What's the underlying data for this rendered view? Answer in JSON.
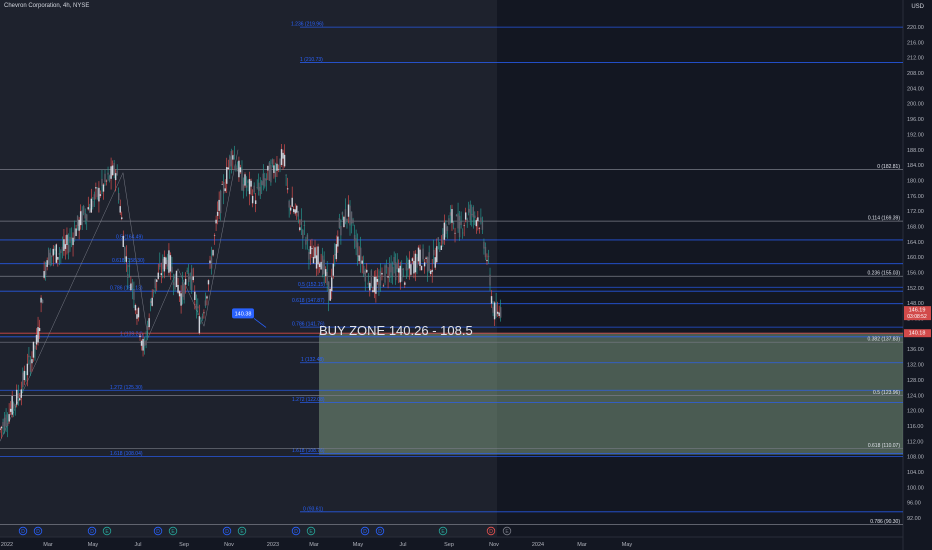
{
  "header": {
    "title": "Chevron Corporation, 4h, NYSE",
    "currency": "USD"
  },
  "buy_zone_label": "BUY ZONE 140.26 - 108.5",
  "colors": {
    "bg": "#131722",
    "fib_line": "#2962ff",
    "fib_text": "#2962ff",
    "white_line": "#787b86",
    "zone_fill": "#8fb08f",
    "up": "#c8c8c8",
    "down": "#c8c8c8",
    "price_tag": "#d24a4a"
  },
  "chart_data": {
    "type": "candlestick",
    "y_axis": {
      "range": [
        92,
        222
      ],
      "ticks": [
        92,
        96,
        100,
        104,
        108,
        112,
        116,
        120,
        124,
        128,
        132,
        136,
        140,
        144,
        148,
        152,
        156,
        160,
        164,
        168,
        172,
        176,
        180,
        184,
        188,
        192,
        196,
        200,
        204,
        208,
        212,
        216,
        220
      ],
      "labels": [
        "92.00",
        "96.00",
        "100.00",
        "104.00",
        "108.00",
        "112.00",
        "116.00",
        "120.00",
        "124.00",
        "128.00",
        "132.00",
        "136.00",
        "140.00",
        "144.00",
        "148.00",
        "152.00",
        "156.00",
        "160.00",
        "164.00",
        "168.00",
        "172.00",
        "176.00",
        "180.00",
        "184.00",
        "188.00",
        "192.00",
        "196.00",
        "200.00",
        "204.00",
        "208.00",
        "212.00",
        "216.00",
        "220.00"
      ]
    },
    "x_axis": {
      "labels": [
        "2022",
        "Mar",
        "May",
        "Jul",
        "Sep",
        "Nov",
        "2023",
        "Mar",
        "May",
        "Jul",
        "Sep",
        "Nov",
        "2024",
        "Mar",
        "May"
      ]
    },
    "fib_levels": [
      {
        "text": "1.236 (219.96)",
        "price": 219.96,
        "scope": "upper"
      },
      {
        "text": "1 (210.73)",
        "price": 210.73,
        "scope": "upper"
      },
      {
        "text": "0.5 (164.49)",
        "price": 164.49,
        "scope": "left"
      },
      {
        "text": "0.618 (158.30)",
        "price": 158.3,
        "scope": "left"
      },
      {
        "text": "0.786 (151.13)",
        "price": 151.13,
        "scope": "left"
      },
      {
        "text": "1 (139.24)",
        "price": 139.24,
        "scope": "left"
      },
      {
        "text": "1.272 (125.30)",
        "price": 125.3,
        "scope": "left"
      },
      {
        "text": "1.618 (108.04)",
        "price": 108.04,
        "scope": "left"
      },
      {
        "text": "0.5 (152.15)",
        "price": 152.15,
        "scope": "mid"
      },
      {
        "text": "0.618 (147.87)",
        "price": 147.87,
        "scope": "mid"
      },
      {
        "text": "0.786 (141.76)",
        "price": 141.76,
        "scope": "mid"
      },
      {
        "text": "1 (132.48)",
        "price": 132.48,
        "scope": "mid"
      },
      {
        "text": "1.272 (122.08)",
        "price": 122.08,
        "scope": "mid"
      },
      {
        "text": "1.618 (108.76)",
        "price": 108.76,
        "scope": "mid"
      },
      {
        "text": "0 (93.61)",
        "price": 93.61,
        "scope": "mid"
      }
    ],
    "right_fib_levels": [
      {
        "text": "0 (182.81)",
        "price": 182.81
      },
      {
        "text": "0.114 (169.39)",
        "price": 169.39
      },
      {
        "text": "0.236 (155.03)",
        "price": 155.03
      },
      {
        "text": "0.382 (137.83)",
        "price": 137.83
      },
      {
        "text": "0.5 (123.96)",
        "price": 123.96
      },
      {
        "text": "0.618 (110.07)",
        "price": 110.07
      },
      {
        "text": "0.786 (90.30)",
        "price": 90.3
      }
    ],
    "buy_zone": {
      "top": 140.26,
      "bottom": 108.5
    },
    "price_tags": [
      {
        "text": "146.19",
        "sub": "03:08:52",
        "price": 146.19
      },
      {
        "text": "140.18",
        "price": 140.18
      }
    ],
    "callout": {
      "text": "140.38",
      "price": 140.38
    },
    "event_markers": [
      "D",
      "D",
      "D",
      "E",
      "D",
      "E",
      "D",
      "E",
      "D",
      "E",
      "D",
      "D",
      "E",
      "D",
      "E"
    ],
    "price_path": [
      [
        0.0,
        115
      ],
      [
        0.02,
        124
      ],
      [
        0.04,
        138
      ],
      [
        0.05,
        160
      ],
      [
        0.07,
        162
      ],
      [
        0.09,
        171
      ],
      [
        0.11,
        178
      ],
      [
        0.125,
        183
      ],
      [
        0.135,
        160
      ],
      [
        0.145,
        150
      ],
      [
        0.155,
        135
      ],
      [
        0.165,
        152
      ],
      [
        0.18,
        160
      ],
      [
        0.195,
        150
      ],
      [
        0.205,
        156
      ],
      [
        0.215,
        142
      ],
      [
        0.225,
        155
      ],
      [
        0.235,
        172
      ],
      [
        0.25,
        188
      ],
      [
        0.26,
        180
      ],
      [
        0.275,
        176
      ],
      [
        0.29,
        182
      ],
      [
        0.305,
        186
      ],
      [
        0.31,
        175
      ],
      [
        0.325,
        168
      ],
      [
        0.335,
        160
      ],
      [
        0.345,
        160
      ],
      [
        0.355,
        150
      ],
      [
        0.365,
        168
      ],
      [
        0.375,
        172
      ],
      [
        0.385,
        162
      ],
      [
        0.395,
        155
      ],
      [
        0.405,
        152
      ],
      [
        0.42,
        158
      ],
      [
        0.435,
        155
      ],
      [
        0.45,
        160
      ],
      [
        0.465,
        158
      ],
      [
        0.475,
        165
      ],
      [
        0.485,
        170
      ],
      [
        0.495,
        168
      ],
      [
        0.505,
        172
      ],
      [
        0.515,
        170
      ],
      [
        0.52,
        165
      ],
      [
        0.525,
        158
      ],
      [
        0.53,
        147
      ],
      [
        0.535,
        144
      ],
      [
        0.54,
        148
      ]
    ]
  }
}
